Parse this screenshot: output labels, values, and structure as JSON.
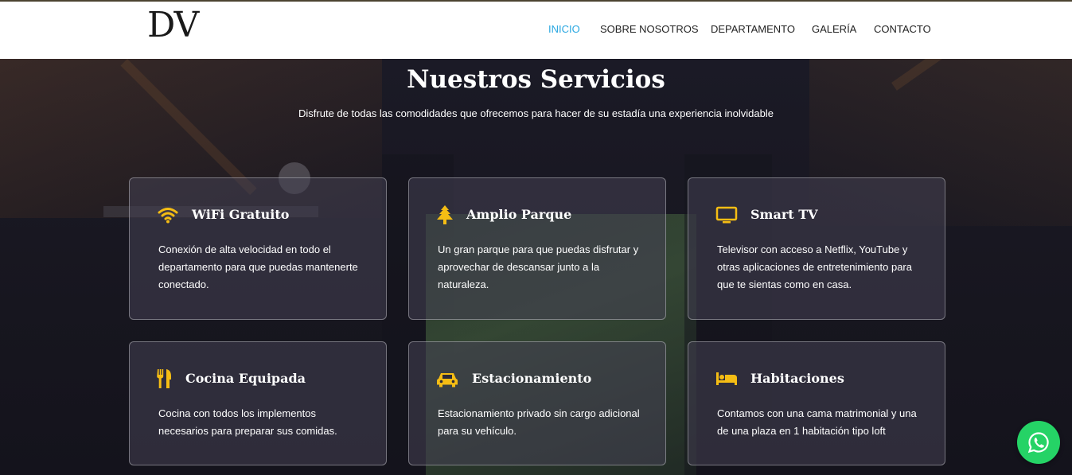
{
  "header": {
    "logo": "DV",
    "nav": [
      {
        "label": "INICIO",
        "active": true
      },
      {
        "label": "SOBRE NOSOTROS",
        "active": false
      },
      {
        "label": "DEPARTAMENTO",
        "active": false
      },
      {
        "label": "GALERÍA",
        "active": false
      },
      {
        "label": "CONTACTO",
        "active": false
      }
    ]
  },
  "services": {
    "title": "Nuestros Servicios",
    "subtitle": "Disfrute de todas las comodidades que ofrecemos para hacer de su estadía una experiencia inolvidable",
    "cards": [
      {
        "icon": "wifi-icon",
        "title": "WiFi Gratuito",
        "desc": "Conexión de alta velocidad en todo el departamento para que puedas mantenerte conectado."
      },
      {
        "icon": "tree-icon",
        "title": "Amplio Parque",
        "desc": "Un gran parque para que puedas disfrutar y aprovechar de descansar junto a la naturaleza."
      },
      {
        "icon": "tv-icon",
        "title": "Smart TV",
        "desc": "Televisor con acceso a Netflix, YouTube y otras aplicaciones de entretenimiento para que te sientas como en casa."
      },
      {
        "icon": "utensils-icon",
        "title": "Cocina Equipada",
        "desc": "Cocina con todos los implementos necesarios para preparar sus comidas."
      },
      {
        "icon": "car-icon",
        "title": "Estacionamiento",
        "desc": "Estacionamiento privado sin cargo adicional para su vehículo."
      },
      {
        "icon": "bed-icon",
        "title": "Habitaciones",
        "desc": "Contamos con una cama matrimonial y una de una plaza en 1 habitación tipo loft"
      }
    ]
  },
  "colors": {
    "accent": "#f5bd14",
    "nav_active": "#29a7e1",
    "whatsapp": "#25d366"
  }
}
